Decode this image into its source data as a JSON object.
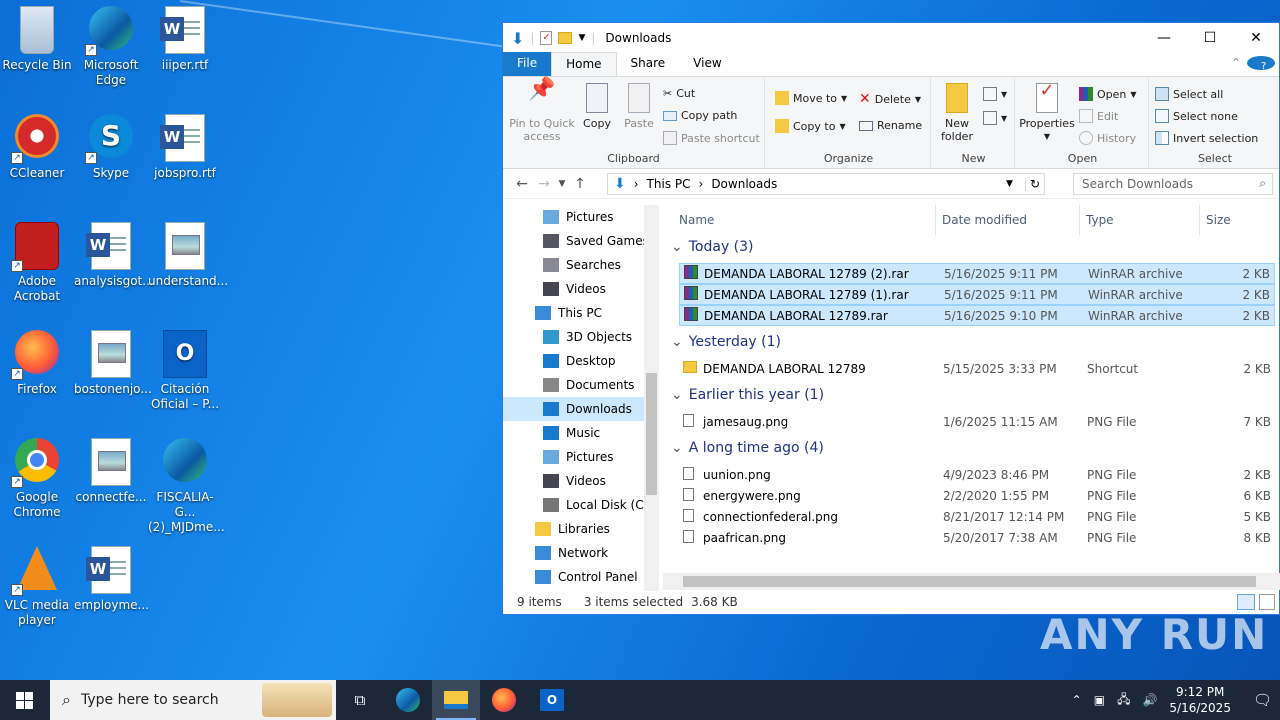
{
  "desktop": {
    "icons": [
      {
        "label": "Recycle Bin"
      },
      {
        "label": "Microsoft Edge"
      },
      {
        "label": "iiiper.rtf"
      },
      {
        "label": "CCleaner"
      },
      {
        "label": "Skype"
      },
      {
        "label": "jobspro.rtf"
      },
      {
        "label": "Adobe Acrobat"
      },
      {
        "label": "analysisgot..."
      },
      {
        "label": "understand..."
      },
      {
        "label": "Firefox"
      },
      {
        "label": "bostonenjo..."
      },
      {
        "label": "Citación Oficial – P..."
      },
      {
        "label": "Google Chrome"
      },
      {
        "label": "connectfe..."
      },
      {
        "label": "FISCALIA-G... (2)_MJDme..."
      },
      {
        "label": "VLC media player"
      },
      {
        "label": "employme..."
      }
    ]
  },
  "explorer": {
    "title": "Downloads",
    "tabs": [
      "File",
      "Home",
      "Share",
      "View"
    ],
    "ribbon": {
      "clipboard": {
        "pin": "Pin to Quick access",
        "copy": "Copy",
        "paste": "Paste",
        "cut": "Cut",
        "copy_path": "Copy path",
        "paste_shortcut": "Paste shortcut",
        "label": "Clipboard"
      },
      "organize": {
        "move_to": "Move to",
        "copy_to": "Copy to",
        "delete": "Delete",
        "rename": "Rename",
        "label": "Organize"
      },
      "new": {
        "new_folder": "New folder",
        "label": "New"
      },
      "open": {
        "properties": "Properties",
        "open": "Open",
        "edit": "Edit",
        "history": "History",
        "label": "Open"
      },
      "select": {
        "select_all": "Select all",
        "select_none": "Select none",
        "invert": "Invert selection",
        "label": "Select"
      }
    },
    "address": {
      "crumbs": [
        "This PC",
        "Downloads"
      ],
      "search_placeholder": "Search Downloads"
    },
    "nav": [
      {
        "label": "Pictures",
        "indent": 2
      },
      {
        "label": "Saved Games",
        "indent": 2
      },
      {
        "label": "Searches",
        "indent": 2
      },
      {
        "label": "Videos",
        "indent": 2
      },
      {
        "label": "This PC",
        "indent": 1
      },
      {
        "label": "3D Objects",
        "indent": 2
      },
      {
        "label": "Desktop",
        "indent": 2
      },
      {
        "label": "Documents",
        "indent": 2
      },
      {
        "label": "Downloads",
        "indent": 2,
        "selected": true
      },
      {
        "label": "Music",
        "indent": 2
      },
      {
        "label": "Pictures",
        "indent": 2
      },
      {
        "label": "Videos",
        "indent": 2
      },
      {
        "label": "Local Disk (C:)",
        "indent": 2
      },
      {
        "label": "Libraries",
        "indent": 1
      },
      {
        "label": "Network",
        "indent": 1
      },
      {
        "label": "Control Panel",
        "indent": 1
      }
    ],
    "columns": {
      "name": "Name",
      "date": "Date modified",
      "type": "Type",
      "size": "Size"
    },
    "groups": [
      {
        "title": "Today (3)",
        "files": [
          {
            "name": "DEMANDA LABORAL 12789 (2).rar",
            "date": "5/16/2025 9:11 PM",
            "type": "WinRAR archive",
            "size": "2 KB",
            "selected": true,
            "icon": "rar"
          },
          {
            "name": "DEMANDA LABORAL 12789 (1).rar",
            "date": "5/16/2025 9:11 PM",
            "type": "WinRAR archive",
            "size": "2 KB",
            "selected": true,
            "icon": "rar"
          },
          {
            "name": "DEMANDA LABORAL 12789.rar",
            "date": "5/16/2025 9:10 PM",
            "type": "WinRAR archive",
            "size": "2 KB",
            "selected": true,
            "icon": "rar"
          }
        ]
      },
      {
        "title": "Yesterday (1)",
        "files": [
          {
            "name": "DEMANDA LABORAL 12789",
            "date": "5/15/2025 3:33 PM",
            "type": "Shortcut",
            "size": "2 KB",
            "icon": "shortcut"
          }
        ]
      },
      {
        "title": "Earlier this year (1)",
        "files": [
          {
            "name": "jamesaug.png",
            "date": "1/6/2025 11:15 AM",
            "type": "PNG File",
            "size": "7 KB",
            "icon": "png"
          }
        ]
      },
      {
        "title": "A long time ago (4)",
        "files": [
          {
            "name": "uunion.png",
            "date": "4/9/2023 8:46 PM",
            "type": "PNG File",
            "size": "2 KB",
            "icon": "png"
          },
          {
            "name": "energywere.png",
            "date": "2/2/2020 1:55 PM",
            "type": "PNG File",
            "size": "6 KB",
            "icon": "png"
          },
          {
            "name": "connectionfederal.png",
            "date": "8/21/2017 12:14 PM",
            "type": "PNG File",
            "size": "5 KB",
            "icon": "png"
          },
          {
            "name": "paafrican.png",
            "date": "5/20/2017 7:38 AM",
            "type": "PNG File",
            "size": "8 KB",
            "icon": "png"
          }
        ]
      }
    ],
    "status": {
      "items": "9 items",
      "selected": "3 items selected",
      "size": "3.68 KB"
    }
  },
  "taskbar": {
    "search_placeholder": "Type here to search",
    "time": "9:12 PM",
    "date": "5/16/2025"
  },
  "watermark": "ANY RUN",
  "colors": {
    "accent": "#1979ca",
    "selection": "#cce8ff",
    "taskbar": "#1c2838"
  }
}
